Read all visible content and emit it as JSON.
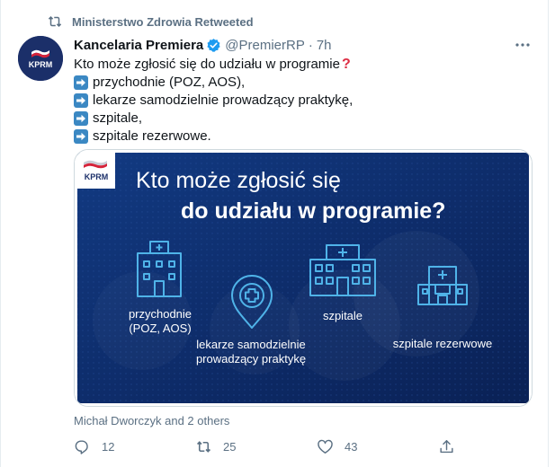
{
  "retweet": {
    "label": "Ministerstwo Zdrowia Retweeted"
  },
  "tweet": {
    "author_name": "Kancelaria Premiera",
    "handle": "@PremierRP",
    "separator": "·",
    "time": "7h",
    "avatar_text": "KPRM",
    "lines": [
      "Kto może zgłosić się do udziału w programie",
      "przychodnie (POZ, AOS),",
      "lekarze samodzielnie prowadzący praktykę,",
      "szpitale,",
      "szpitale rezerwowe."
    ],
    "icons": {
      "question": "red-question-mark-emoji",
      "bullet": "right-arrow-emoji",
      "verified": "verified-badge-icon"
    }
  },
  "media": {
    "logo_text": "KPRM",
    "heading_line1": "Kto może zgłosić się",
    "heading_line2": "do udziału w programie?",
    "items": [
      {
        "label_1": "przychodnie",
        "label_2": "(POZ, AOS)",
        "icon": "clinic-building-icon"
      },
      {
        "label_1": "lekarze samodzielnie",
        "label_2": "prowadzący praktykę",
        "icon": "location-pin-cross-icon"
      },
      {
        "label_1": "szpitale",
        "icon": "hospital-building-icon"
      },
      {
        "label_1": "szpitale rezerwowe",
        "icon": "reserve-hospital-icon"
      }
    ],
    "colors": {
      "background": "#0d2a66",
      "accent": "#4fb3e8",
      "text": "#ffffff"
    }
  },
  "likes_line": "Michał Dworczyk and 2 others",
  "actions": {
    "reply_count": "12",
    "retweet_count": "25",
    "like_count": "43",
    "share_count": ""
  },
  "colors": {
    "muted": "#5b7083",
    "text": "#0f1419",
    "border": "#cfd9de",
    "verified": "#1d9bf0"
  }
}
